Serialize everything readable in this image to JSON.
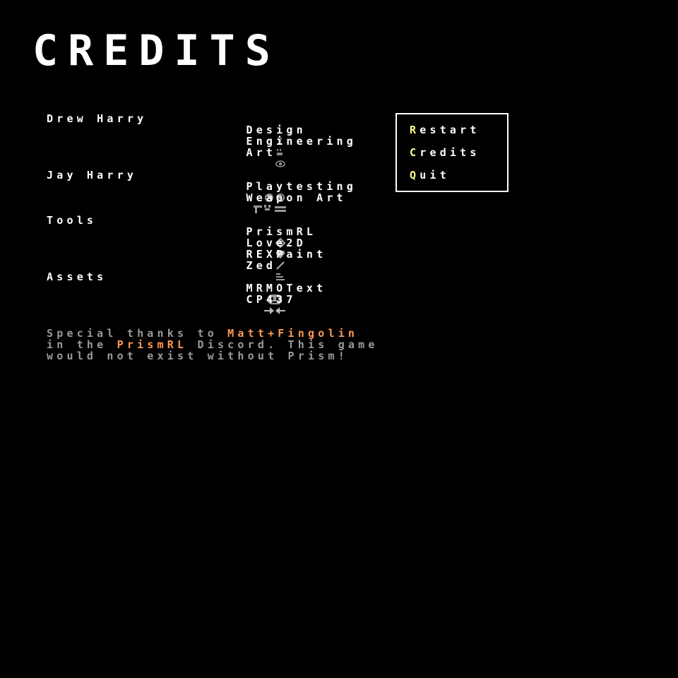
{
  "title": "CREDITS",
  "sections": [
    {
      "name": "Drew Harry",
      "items": [
        {
          "icon": "scroll-icon",
          "label": "Design"
        },
        {
          "icon": "chip-icon",
          "label": "Engineering"
        },
        {
          "icon": "eye-icon",
          "label": "Art"
        }
      ]
    },
    {
      "name": "Jay Harry",
      "items": [
        {
          "icon": "gamepad-icon",
          "label": "Playtesting"
        },
        {
          "icon": "gun-icon",
          "label": "Weapon Art"
        }
      ]
    },
    {
      "name": "Tools",
      "items": [
        {
          "icon": "prism-icon",
          "label": "PrismRL"
        },
        {
          "icon": "heart-icon",
          "label": "Love2D"
        },
        {
          "icon": "brush-icon",
          "label": "REXPaint"
        },
        {
          "icon": "text-editor-icon",
          "label": "Zed"
        }
      ]
    },
    {
      "name": "Assets",
      "items": [
        {
          "icon": "skull-icon",
          "label": "MRMOText"
        },
        {
          "icon": "arrows-icon",
          "label": "CP437"
        }
      ]
    }
  ],
  "thanks": {
    "line1_a": "Special thanks to ",
    "line1_b": "Matt+Fingolin",
    "line2_a": "in the ",
    "line2_b": "PrismRL",
    "line2_c": " Discord. This game",
    "line3": "would not exist without Prism!"
  },
  "menu": {
    "items": [
      {
        "hotkey": "R",
        "rest": "estart"
      },
      {
        "hotkey": "C",
        "rest": "redits"
      },
      {
        "hotkey": "Q",
        "rest": "uit"
      }
    ]
  },
  "colors": {
    "background": "#000000",
    "text": "#ffffff",
    "dim_text": "#9a9a9a",
    "highlight": "#ff9955",
    "hotkey": "#ffff88"
  }
}
